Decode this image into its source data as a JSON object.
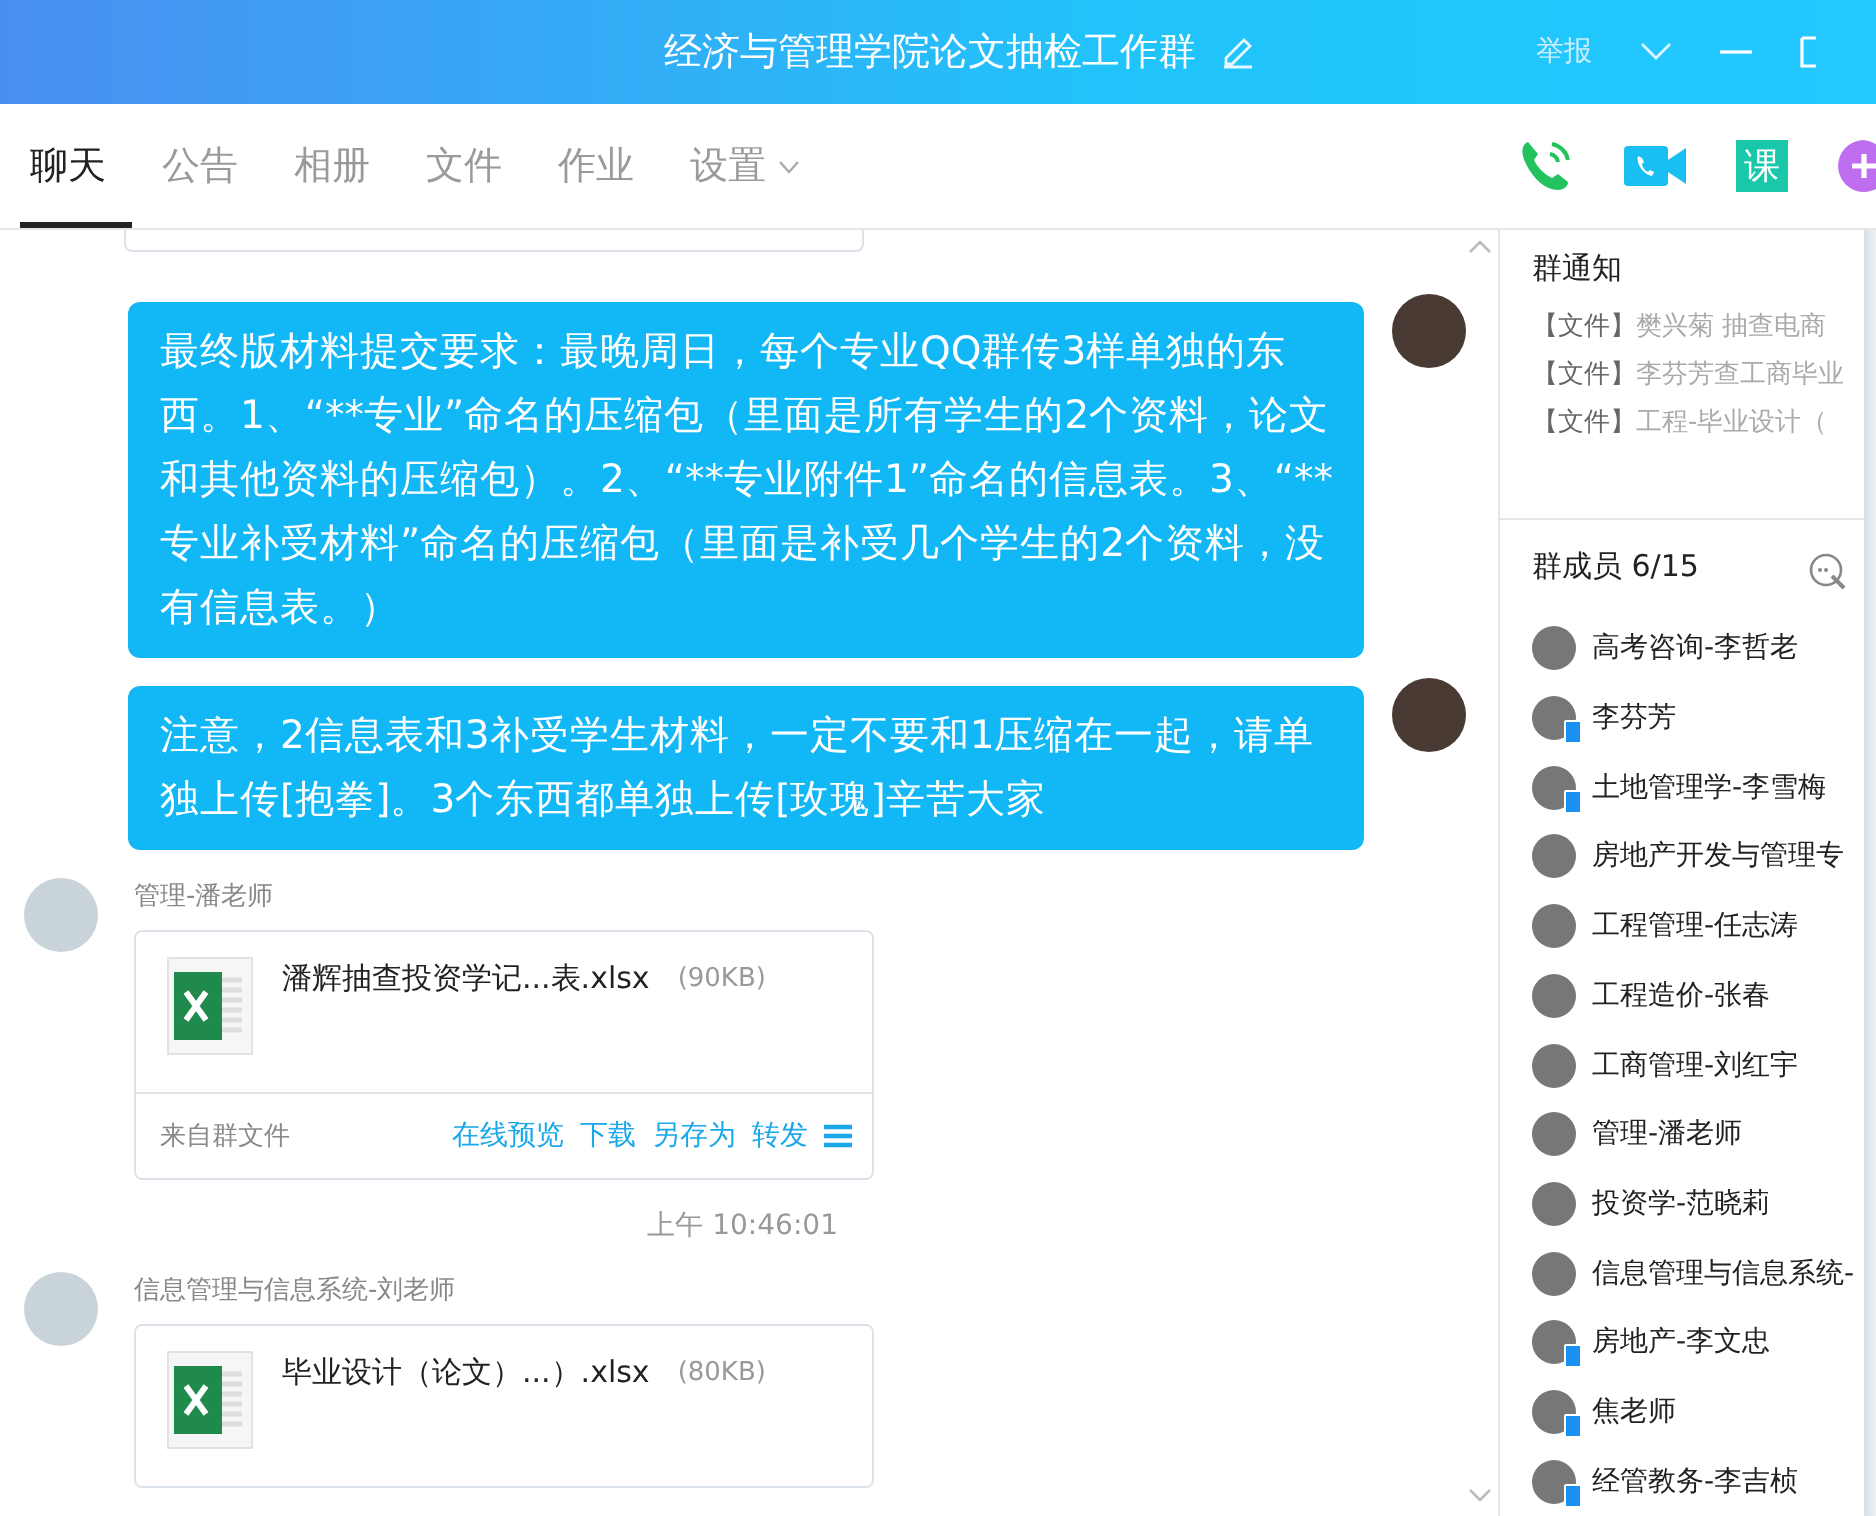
{
  "window": {
    "title": "经济与管理学院论文抽检工作群",
    "report": "举报"
  },
  "tabs": [
    {
      "label": "聊天",
      "selected": true,
      "dropdown": false
    },
    {
      "label": "公告",
      "selected": false,
      "dropdown": false
    },
    {
      "label": "相册",
      "selected": false,
      "dropdown": false
    },
    {
      "label": "文件",
      "selected": false,
      "dropdown": false
    },
    {
      "label": "作业",
      "selected": false,
      "dropdown": false
    },
    {
      "label": "设置",
      "selected": false,
      "dropdown": true
    }
  ],
  "toolbar": [
    {
      "kind": "phone"
    },
    {
      "kind": "video"
    },
    {
      "kind": "lesson",
      "text": "课"
    },
    {
      "kind": "add"
    }
  ],
  "messages": [
    {
      "kind": "text",
      "text": "最终版材料提交要求：最晚周日，每个专业QQ群传3样单独的东西。1、“**专业”命名的压缩包（里面是所有学生的2个资料，论文和其他资料的压缩包）。2、“**专业附件1”命名的信息表。3、“**专业补受材料”命名的压缩包（里面是补受几个学生的2个资料，没有信息表。）"
    },
    {
      "kind": "text",
      "text": "注意，2信息表和3补受学生材料，一定不要和1压缩在一起，请单独上传[抱拳]。3个东西都单独上传[玫瑰]辛苦大家"
    },
    {
      "kind": "file",
      "sender": "管理-潘老师",
      "file": "潘辉抽查投资学记...表.xlsx",
      "size": "(90KB)",
      "source": "来自群文件",
      "actions": [
        "在线预览",
        "下载",
        "另存为",
        "转发"
      ]
    },
    {
      "kind": "time",
      "text": "上午 10:46:01"
    },
    {
      "kind": "file",
      "sender": "信息管理与信息系统-刘老师",
      "file": "毕业设计（论文）...）.xlsx",
      "size": "(80KB)"
    }
  ],
  "notice": {
    "title": "群通知",
    "items": [
      {
        "tag": "【文件】",
        "text": "樊兴菊  抽查电商"
      },
      {
        "tag": "【文件】",
        "text": "李芬芳查工商毕业"
      },
      {
        "tag": "【文件】",
        "text": "工程-毕业设计（"
      }
    ]
  },
  "members": {
    "title": "群成员 6/15",
    "items": [
      {
        "name": "高考咨询-李哲老",
        "mobile": false
      },
      {
        "name": "李芬芳",
        "mobile": true
      },
      {
        "name": "土地管理学-李雪梅",
        "mobile": true
      },
      {
        "name": "房地产开发与管理专",
        "mobile": false
      },
      {
        "name": "工程管理-任志涛",
        "mobile": false
      },
      {
        "name": "工程造价-张春",
        "mobile": false
      },
      {
        "name": "工商管理-刘红宇",
        "mobile": false
      },
      {
        "name": "管理-潘老师",
        "mobile": false
      },
      {
        "name": "投资学-范晓莉",
        "mobile": false
      },
      {
        "name": "信息管理与信息系统-",
        "mobile": false
      },
      {
        "name": "房地产-李文忠",
        "mobile": true
      },
      {
        "name": "焦老师",
        "mobile": true
      },
      {
        "name": "经管教务-李吉桢",
        "mobile": true
      }
    ]
  }
}
